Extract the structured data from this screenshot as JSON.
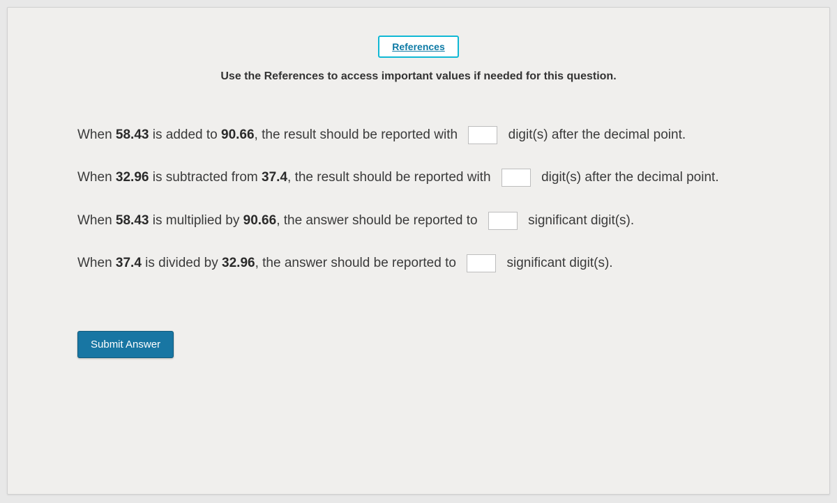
{
  "header": {
    "references_label": "References",
    "instruction": "Use the References to access important values if needed for this question."
  },
  "questions": {
    "q1": {
      "pre": "When ",
      "num1": "58.43",
      "mid1": " is added to ",
      "num2": "90.66",
      "mid2": ", the result should be reported with ",
      "post": " digit(s) after the decimal point."
    },
    "q2": {
      "pre": "When ",
      "num1": "32.96",
      "mid1": " is subtracted from ",
      "num2": "37.4",
      "mid2": ", the result should be reported with ",
      "post": " digit(s) after the decimal point."
    },
    "q3": {
      "pre": "When ",
      "num1": "58.43",
      "mid1": " is multiplied by ",
      "num2": "90.66",
      "mid2": ", the answer should be reported to ",
      "post": " significant digit(s)."
    },
    "q4": {
      "pre": "When ",
      "num1": "37.4",
      "mid1": " is divided by ",
      "num2": "32.96",
      "mid2": ", the answer should be reported to ",
      "post": " significant digit(s)."
    }
  },
  "submit_label": "Submit Answer"
}
